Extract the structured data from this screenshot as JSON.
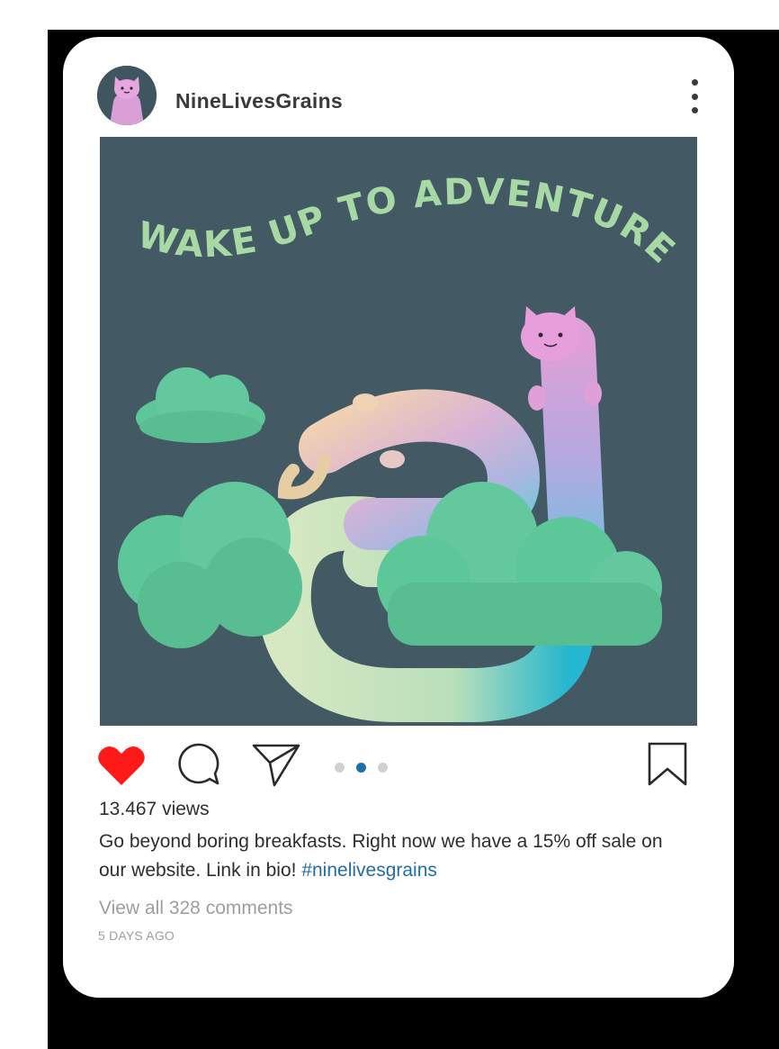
{
  "post": {
    "username": "NineLivesGrains",
    "image_text": "WAKE UP TO ADVENTURE",
    "views": "13.467 views",
    "caption_text": "Go beyond boring breakfasts. Right now we have a 15% off sale on our website. Link in bio!",
    "hashtag": "#ninelivesgrains",
    "comments_link": "View all 328 comments",
    "timestamp": "5 DAYS AGO",
    "carousel": {
      "count": 3,
      "active_index": 1
    },
    "liked": true
  },
  "icons": {
    "like": "heart-icon",
    "comment": "speech-bubble-icon",
    "share": "paper-plane-icon",
    "save": "bookmark-icon",
    "more": "more-vertical-icon"
  },
  "colors": {
    "heart": "#ff1a1a",
    "hashtag": "#1f6fa8",
    "image_background": "#435963",
    "cloud": "#5ec79a",
    "title_text": "#a6d9a4"
  }
}
